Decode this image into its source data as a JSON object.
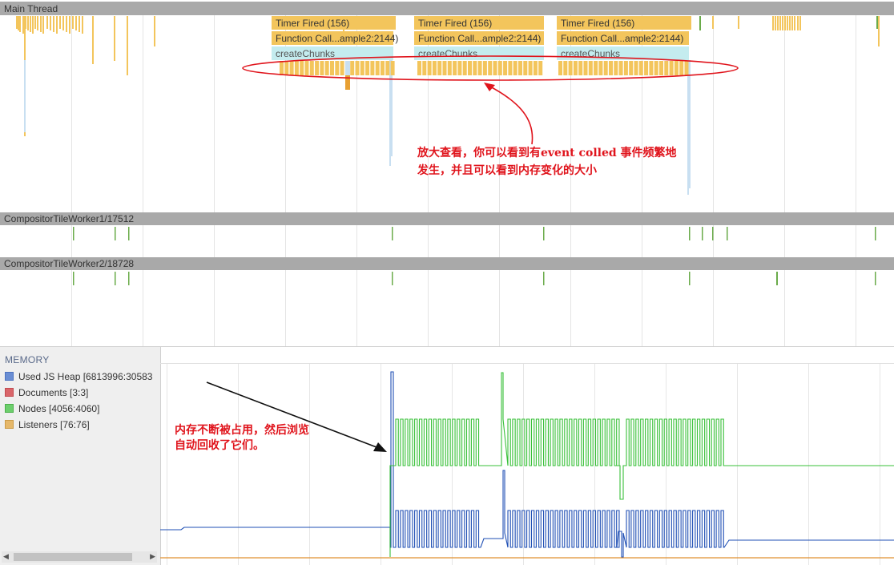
{
  "tracks": {
    "main_thread": "Main Thread",
    "worker1": "CompositorTileWorker1/17512",
    "worker2": "CompositorTileWorker2/18728"
  },
  "events": {
    "timer_fired": "Timer Fired (156)",
    "function_call": "Function Call...ample2:2144)",
    "create_chunks": "createChunks"
  },
  "annotations": {
    "top_line1": "放大查看，你可以看到有event colled 事件频繁地",
    "top_line2": "发生，并且可以看到内存变化的大小",
    "bottom_line1": "内存不断被占用，然后浏览",
    "bottom_line2": "自动回收了它们。"
  },
  "memory": {
    "title": "MEMORY",
    "legend": [
      {
        "label": "Used JS Heap [6813996:30583",
        "color": "#6a8ed4"
      },
      {
        "label": "Documents [3:3]",
        "color": "#d9666a"
      },
      {
        "label": "Nodes [4056:4060]",
        "color": "#6ccf6c"
      },
      {
        "label": "Listeners [76:76]",
        "color": "#e6b86a"
      }
    ]
  },
  "colors": {
    "event_fill": "#f3c55c",
    "event_border": "#e0a93a",
    "chunk_fill": "#c4ecef",
    "heap_line": "#1f4fb4",
    "nodes_line": "#38c038",
    "listeners_line": "#e09030",
    "annotation": "#e0141c"
  }
}
